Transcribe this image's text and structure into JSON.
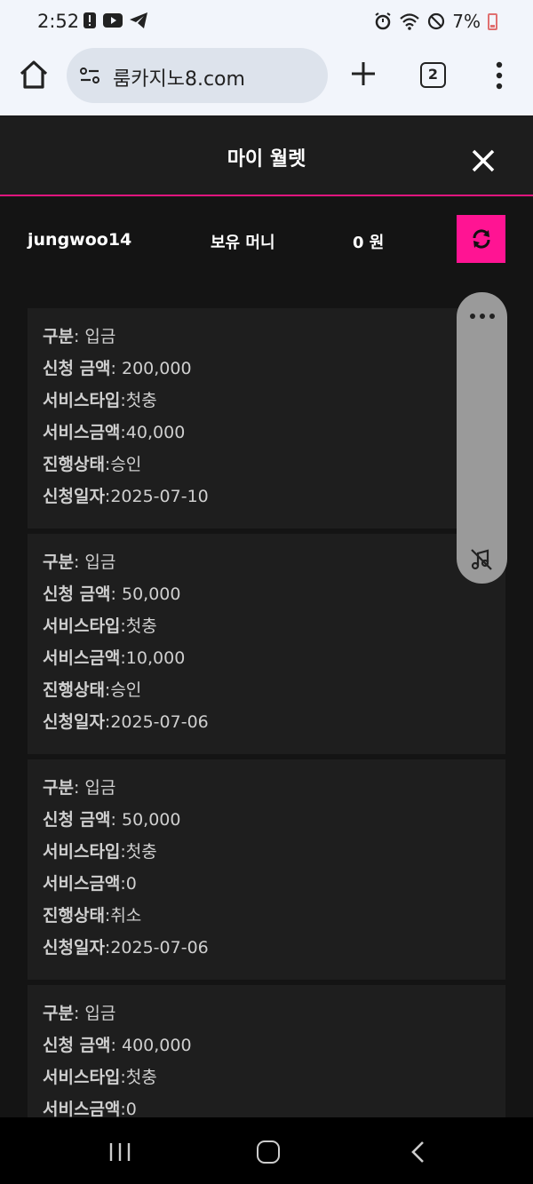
{
  "status_bar": {
    "time": "2:52",
    "battery": "7%",
    "icons_left": [
      "alert-icon",
      "youtube-icon",
      "telegram-icon"
    ],
    "icons_right": [
      "alarm-icon",
      "wifi-icon",
      "do-not-disturb-icon",
      "battery-icon"
    ]
  },
  "browser": {
    "url": "룸카지노8.com",
    "tab_count": "2"
  },
  "wallet": {
    "title": "마이 월렛",
    "username": "jungwoo14",
    "money_label": "보유 머니",
    "money_value": "0 원",
    "accent": "#ff1493"
  },
  "transactions": [
    {
      "type_label": "구분",
      "type_value": ": 입금",
      "amount_label": "신청 금액",
      "amount_value": ": 200,000",
      "service_type_label": "서비스타입",
      "service_type_value": ":첫충",
      "service_amount_label": "서비스금액",
      "service_amount_value": ":40,000",
      "status_label": "진행상태",
      "status_value": ":승인",
      "date_label": "신청일자",
      "date_value": ":2025-07-10"
    },
    {
      "type_label": "구분",
      "type_value": ": 입금",
      "amount_label": "신청 금액",
      "amount_value": ": 50,000",
      "service_type_label": "서비스타입",
      "service_type_value": ":첫충",
      "service_amount_label": "서비스금액",
      "service_amount_value": ":10,000",
      "status_label": "진행상태",
      "status_value": ":승인",
      "date_label": "신청일자",
      "date_value": ":2025-07-06"
    },
    {
      "type_label": "구분",
      "type_value": ": 입금",
      "amount_label": "신청 금액",
      "amount_value": ": 50,000",
      "service_type_label": "서비스타입",
      "service_type_value": ":첫충",
      "service_amount_label": "서비스금액",
      "service_amount_value": ":0",
      "status_label": "진행상태",
      "status_value": ":취소",
      "date_label": "신청일자",
      "date_value": ":2025-07-06"
    },
    {
      "type_label": "구분",
      "type_value": ": 입금",
      "amount_label": "신청 금액",
      "amount_value": ": 400,000",
      "service_type_label": "서비스타입",
      "service_type_value": ":첫충",
      "service_amount_label": "서비스금액",
      "service_amount_value": ":0",
      "status_label": "진행상태",
      "status_value": "",
      "date_label": "신청일자",
      "date_value": ""
    }
  ]
}
